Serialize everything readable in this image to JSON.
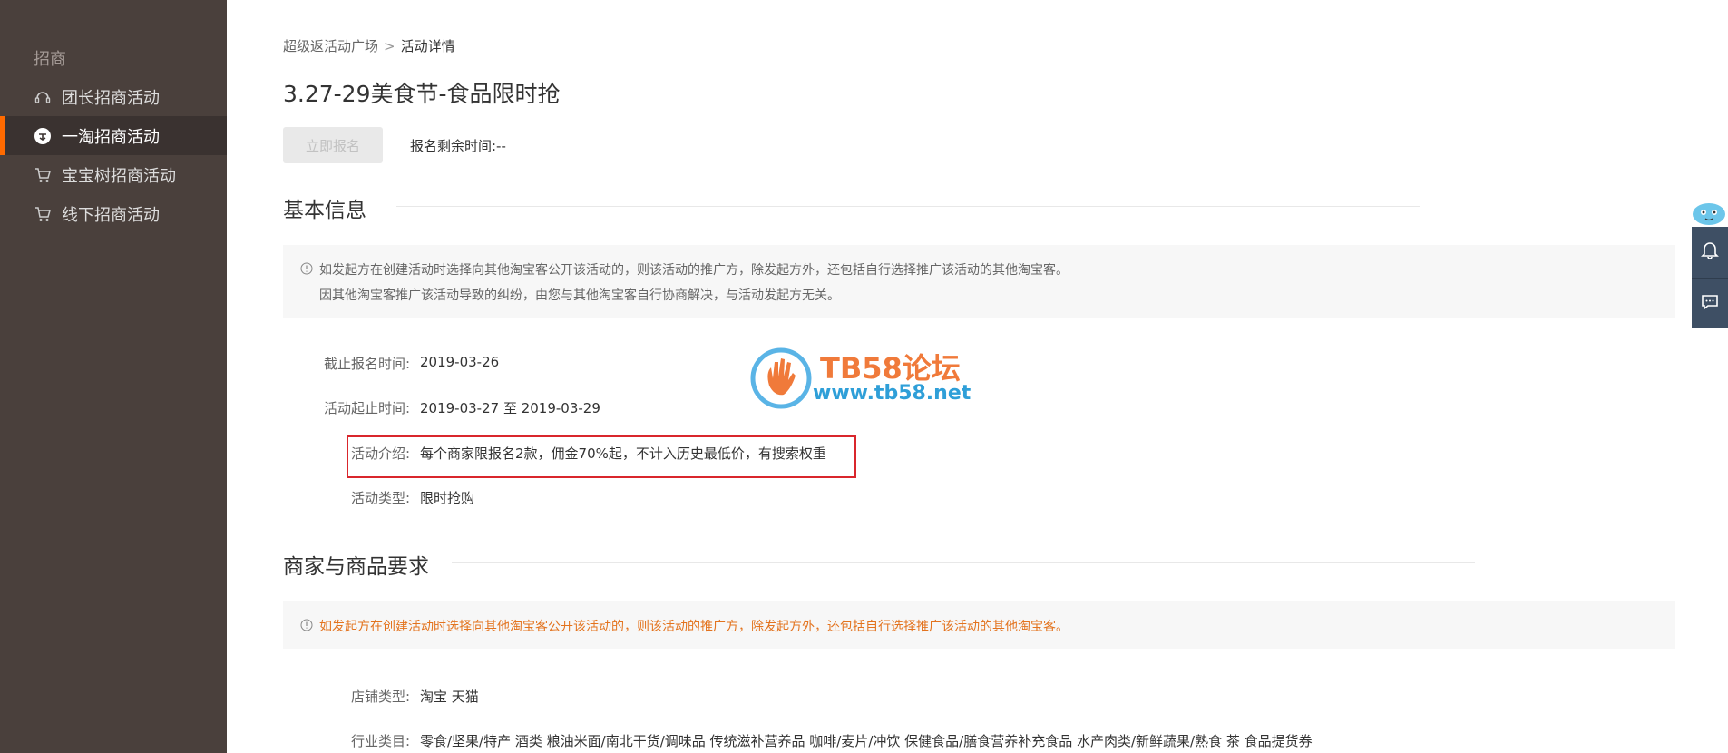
{
  "sidebar": {
    "header": "招商",
    "items": [
      {
        "label": "团长招商活动",
        "icon": "headset-icon",
        "active": false
      },
      {
        "label": "一淘招商活动",
        "icon": "yitao-logo-icon",
        "active": true
      },
      {
        "label": "宝宝树招商活动",
        "icon": "cart-icon",
        "active": false
      },
      {
        "label": "线下招商活动",
        "icon": "cart-icon",
        "active": false
      }
    ]
  },
  "breadcrumb": {
    "parent": "超级返活动广场",
    "separator": ">",
    "current": "活动详情"
  },
  "page": {
    "title": "3.27-29美食节-食品限时抢",
    "signup_button": "立即报名",
    "remaining_time": "报名剩余时间:--"
  },
  "basic_info": {
    "title": "基本信息",
    "notice_line1": "如发起方在创建活动时选择向其他淘宝客公开该活动的，则该活动的推广方，除发起方外，还包括自行选择推广该活动的其他淘宝客。",
    "notice_line2": "因其他淘宝客推广该活动导致的纠纷，由您与其他淘宝客自行协商解决，与活动发起方无关。",
    "fields": [
      {
        "label": "截止报名时间:",
        "value": "2019-03-26"
      },
      {
        "label": "活动起止时间:",
        "value": "2019-03-27 至 2019-03-29"
      },
      {
        "label": "活动介绍:",
        "value": "每个商家限报名2款，佣金70%起，不计入历史最低价，有搜索权重"
      },
      {
        "label": "活动类型:",
        "value": "限时抢购"
      }
    ]
  },
  "requirements": {
    "title": "商家与商品要求",
    "notice_line1": "如发起方在创建活动时选择向其他淘宝客公开该活动的，则该活动的推广方，除发起方外，还包括自行选择推广该活动的其他淘宝客。",
    "fields": [
      {
        "label": "店铺类型:",
        "value": "淘宝 天猫"
      },
      {
        "label": "行业类目:",
        "value": "零食/坚果/特产 酒类 粮油米面/南北干货/调味品 传统滋补营养品 咖啡/麦片/冲饮 保健食品/膳食营养补充食品 水产肉类/新鲜蔬果/熟食 茶 食品提货券"
      }
    ]
  },
  "watermark": {
    "title": "TB58论坛",
    "url": "www.tb58.net"
  },
  "floatbar": {
    "items": [
      "bell-icon",
      "chat-icon"
    ]
  },
  "colors": {
    "sidebar_bg": "#4a403c",
    "accent": "#ff6a00",
    "highlight": "#d9262c",
    "notice_orange": "#e3731e"
  }
}
